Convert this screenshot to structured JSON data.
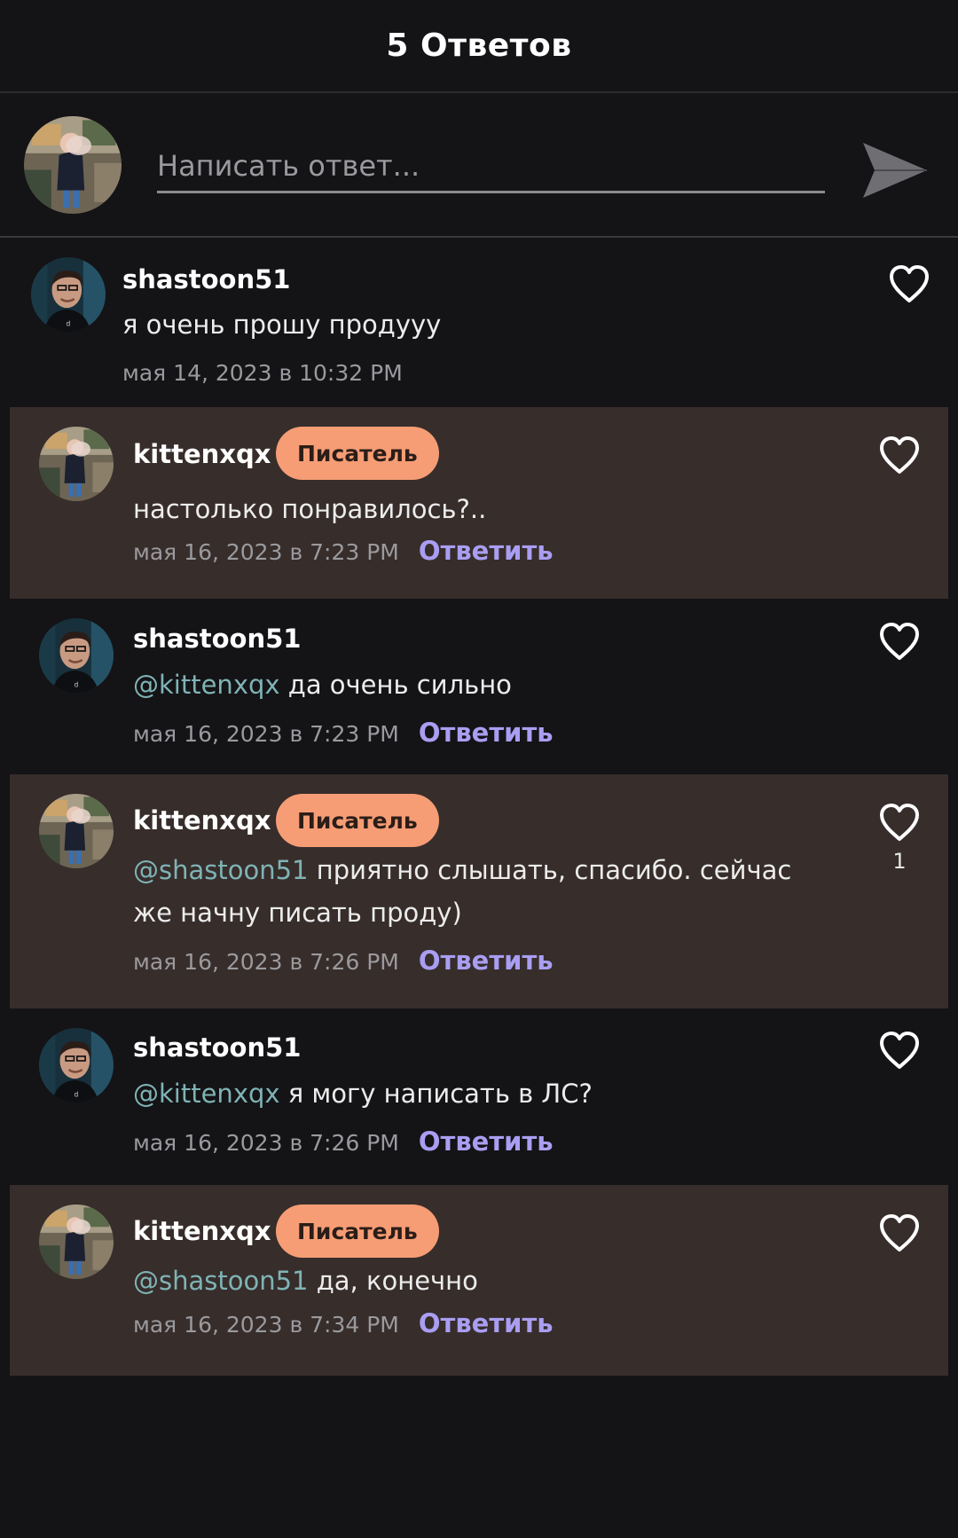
{
  "header": {
    "title": "5 Ответов"
  },
  "composer": {
    "placeholder": "Написать ответ..."
  },
  "colors": {
    "background": "#141316",
    "author_highlight": "#372d2b",
    "badge": "#f69d75",
    "mention": "#7fb3b5",
    "reply": "#a99ef2"
  },
  "comments": [
    {
      "user": "shastoon51",
      "body": "я очень прошу продууу",
      "date": "мая 14, 2023 в 10:32 PM"
    },
    {
      "user": "kittenxqx",
      "badge": "Писатель",
      "body": "настолько понравилось?..",
      "date": "мая 16, 2023 в 7:23 PM",
      "reply": "Ответить"
    },
    {
      "user": "shastoon51",
      "mention": "@kittenxqx",
      "body": " да очень сильно",
      "date": "мая 16, 2023 в 7:23 PM",
      "reply": "Ответить"
    },
    {
      "user": "kittenxqx",
      "badge": "Писатель",
      "mention": "@shastoon51",
      "body": " приятно слышать, спасибо. сейчас же начну писать проду)",
      "date": "мая 16, 2023 в 7:26 PM",
      "reply": "Ответить",
      "likes": "1"
    },
    {
      "user": "shastoon51",
      "mention": "@kittenxqx",
      "body": " я могу написать в ЛС?",
      "date": "мая 16, 2023 в 7:26 PM",
      "reply": "Ответить"
    },
    {
      "user": "kittenxqx",
      "badge": "Писатель",
      "mention": "@shastoon51",
      "body": " да, конечно",
      "date": "мая 16, 2023 в 7:34 PM",
      "reply": "Ответить"
    }
  ]
}
